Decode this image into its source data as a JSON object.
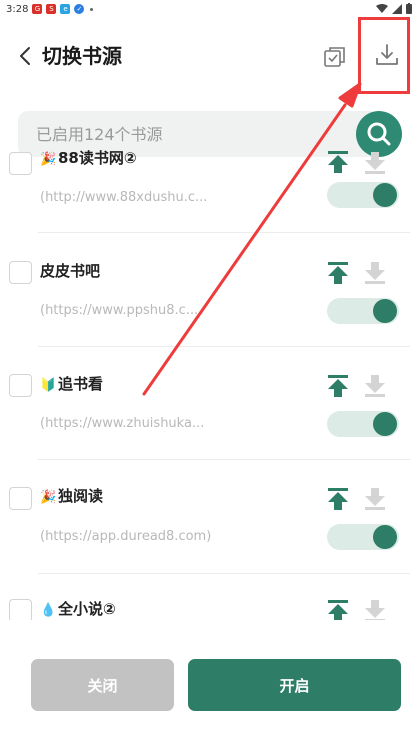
{
  "status_bar": {
    "time": "3:28",
    "icons": [
      "red-square",
      "app-red",
      "app-blue",
      "app-lightblue",
      "dot"
    ],
    "right_icons": [
      "wifi-icon",
      "signal-icon",
      "battery-icon"
    ]
  },
  "header": {
    "title": "切换书源",
    "back_icon": "chevron-left-icon",
    "copy_icon": "copy-icon",
    "download_icon": "download-icon"
  },
  "search": {
    "placeholder": "已启用124个书源",
    "search_icon": "search-icon"
  },
  "sources": [
    {
      "name": "88读书网②",
      "url": "(http://www.88xdushu.c...",
      "enabled": true,
      "emoji": "🎉"
    },
    {
      "name": "皮皮书吧",
      "url": "(https://www.ppshu8.c...",
      "enabled": true,
      "emoji": ""
    },
    {
      "name": "追书看",
      "url": "(https://www.zhuishuka...",
      "enabled": true,
      "emoji": "🔰"
    },
    {
      "name": "独阅读",
      "url": "(https://app.duread8.com)",
      "enabled": true,
      "emoji": "🎉"
    },
    {
      "name": "全小说②",
      "url": "",
      "enabled": true,
      "emoji": "💧"
    }
  ],
  "buttons": {
    "close_label": "关闭",
    "open_label": "开启"
  },
  "colors": {
    "accent": "#2e7d66",
    "search_button": "#2e8a72",
    "annotation": "#ee3b3b",
    "toggle_track": "#dcebe6",
    "disabled_button": "#c2c2c2"
  }
}
